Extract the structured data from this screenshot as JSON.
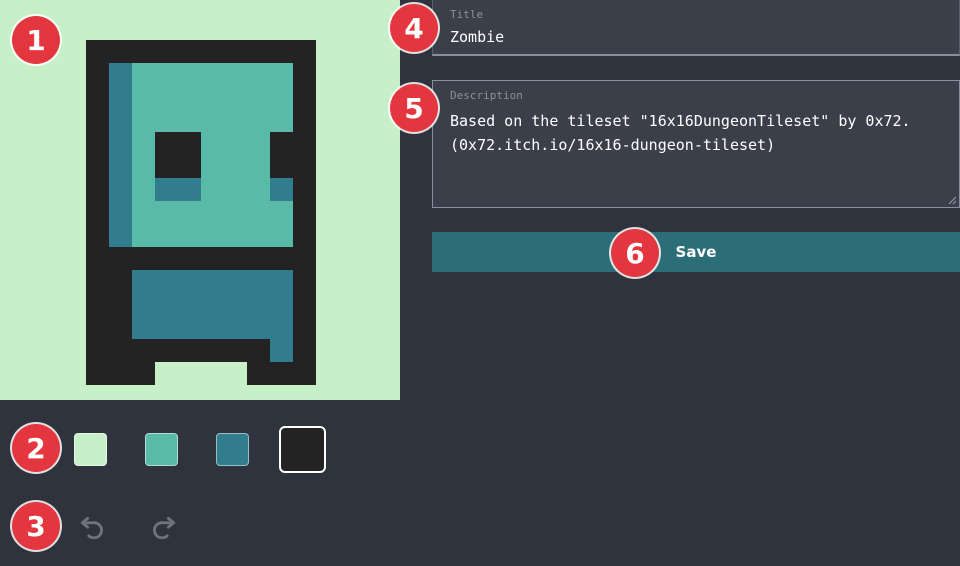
{
  "colors": {
    "palette": [
      "#c8f0c8",
      "#5abaa8",
      "#317d8d",
      "#232323"
    ],
    "selected_index": 3,
    "canvas_background": "#c8f0c8",
    "save_button": "#2c6e78",
    "marker": "#e3363e"
  },
  "history": {
    "undo_icon": "undo-icon",
    "redo_icon": "redo-icon"
  },
  "form": {
    "title": {
      "label": "Title",
      "value": "Zombie"
    },
    "description": {
      "label": "Description",
      "value": "Based on the tileset \"16x16DungeonTileset\" by 0x72.\n(0x72.itch.io/16x16-dungeon-tileset)"
    },
    "save_label": "Save"
  },
  "markers": [
    "1",
    "2",
    "3",
    "4",
    "5",
    "6"
  ]
}
